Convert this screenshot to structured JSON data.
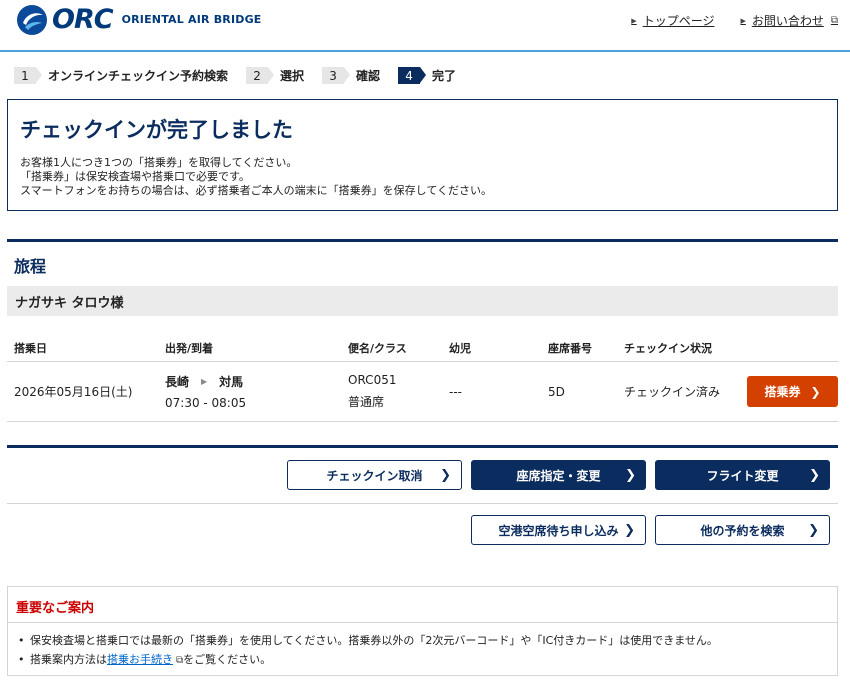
{
  "header": {
    "logo_text": "ORC",
    "logo_sub": "ORIENTAL AIR BRIDGE",
    "links": [
      {
        "label": "トップページ"
      },
      {
        "label": "お問い合わせ"
      }
    ]
  },
  "steps": [
    {
      "num": "1",
      "label": "オンラインチェックイン予約検索"
    },
    {
      "num": "2",
      "label": "選択"
    },
    {
      "num": "3",
      "label": "確認"
    },
    {
      "num": "4",
      "label": "完了"
    }
  ],
  "completion": {
    "title": "チェックインが完了しました",
    "lines": [
      "お客様1人につき1つの「搭乗券」を取得してください。",
      "「搭乗券」は保安検査場や搭乗口で必要です。",
      "スマートフォンをお持ちの場合は、必ず搭乗者ご本人の端末に「搭乗券」を保存してください。"
    ]
  },
  "itinerary": {
    "title": "旅程",
    "passenger": "ナガサキ タロウ様",
    "columns": [
      "搭乗日",
      "出発/到着",
      "便名/クラス",
      "幼児",
      "座席番号",
      "チェックイン状況"
    ],
    "row": {
      "date": "2026年05月16日(土)",
      "from": "長崎",
      "to": "対馬",
      "times": "07:30 - 08:05",
      "flight": "ORC051",
      "class": "普通席",
      "infant": "---",
      "seat": "5D",
      "status": "チェックイン済み",
      "boarding_pass_label": "搭乗券"
    }
  },
  "actions": {
    "cancel_checkin": "チェックイン取消",
    "seat_select": "座席指定・変更",
    "flight_change": "フライト変更",
    "standby": "空港空席待ち申し込み",
    "search_other": "他の予約を検索"
  },
  "notice": {
    "title": "重要なご案内",
    "item1": "保安検査場と搭乗口では最新の「搭乗券」を使用してください。搭乗券以外の「2次元バーコード」や「IC付きカード」は使用できません。",
    "item2_prefix": "搭乗案内方法は",
    "item2_link": "搭乗お手続き",
    "item2_suffix": "をご覧ください。"
  },
  "colors": {
    "navy": "#0b2c5e",
    "accent_blue": "#4aa3df",
    "boarding_orange": "#d44000",
    "notice_red": "#cc0000"
  }
}
